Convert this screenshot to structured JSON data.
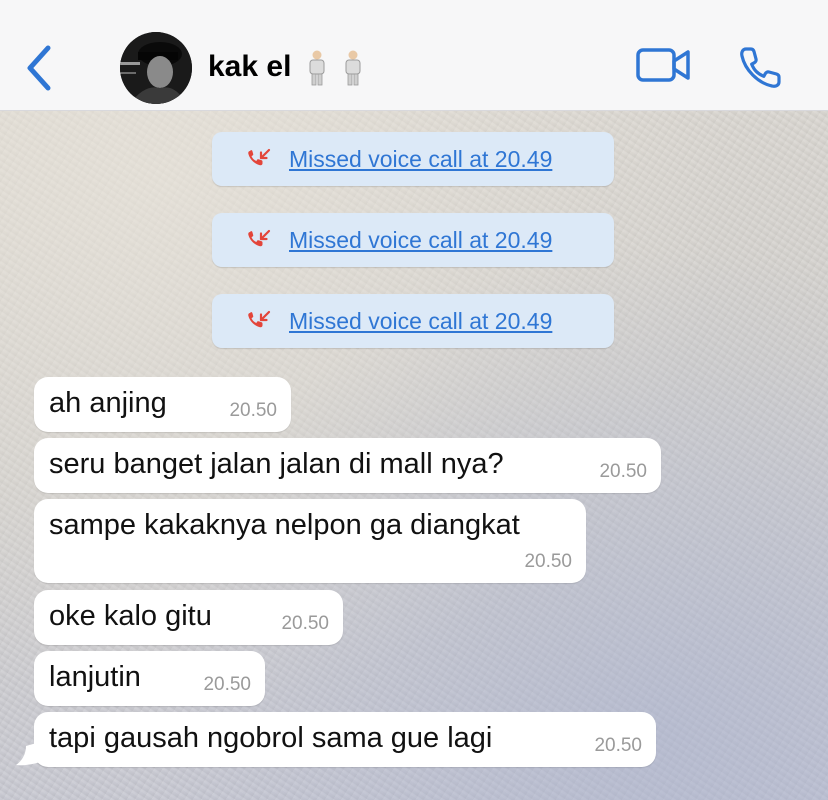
{
  "header": {
    "contact_name": "kak el",
    "emoji_count": 2
  },
  "missed_calls": [
    {
      "label": "Missed voice call at 20.49"
    },
    {
      "label": "Missed voice call at 20.49"
    },
    {
      "label": "Missed voice call at 20.49"
    }
  ],
  "messages": [
    {
      "text": "ah anjing",
      "time": "20.50"
    },
    {
      "text": "seru banget jalan jalan di mall nya?",
      "time": "20.50"
    },
    {
      "text": "sampe kakaknya nelpon ga diangkat",
      "time": "20.50"
    },
    {
      "text": "oke kalo gitu",
      "time": "20.50"
    },
    {
      "text": "lanjutin",
      "time": "20.50"
    },
    {
      "text": "tapi gausah ngobrol sama gue lagi",
      "time": "20.50"
    }
  ],
  "colors": {
    "accent": "#2f76d4",
    "missed_icon": "#e3453a",
    "pill_bg": "#dce9f7",
    "bubble_bg": "#ffffff",
    "timestamp": "#9a9a9a"
  },
  "icons": {
    "back": "chevron-left-icon",
    "video": "video-camera-icon",
    "call": "phone-icon",
    "missed": "missed-call-icon",
    "person": "person-standing-icon"
  }
}
